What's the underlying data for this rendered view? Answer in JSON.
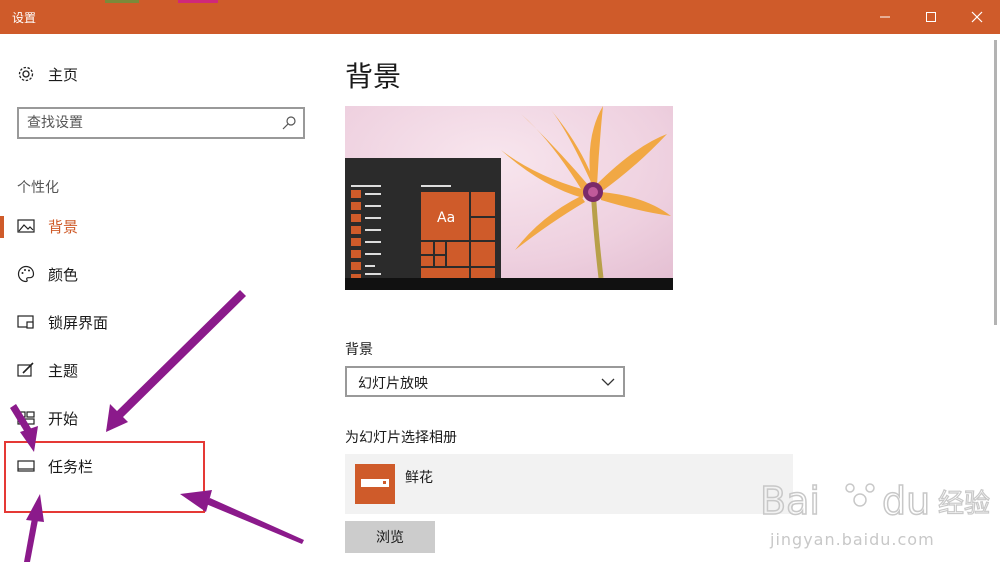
{
  "window": {
    "title": "设置",
    "accent": "#cf5b2a"
  },
  "sidebar": {
    "home_label": "主页",
    "search_placeholder": "查找设置",
    "section_label": "个性化",
    "items": [
      {
        "label": "背景",
        "icon": "picture-icon",
        "active": true
      },
      {
        "label": "颜色",
        "icon": "palette-icon",
        "active": false
      },
      {
        "label": "锁屏界面",
        "icon": "lock-screen-icon",
        "active": false
      },
      {
        "label": "主题",
        "icon": "theme-brush-icon",
        "active": false
      },
      {
        "label": "开始",
        "icon": "start-tiles-icon",
        "active": false
      },
      {
        "label": "任务栏",
        "icon": "taskbar-icon",
        "active": false
      }
    ]
  },
  "main": {
    "page_title": "背景",
    "preview_tile_text": "Aa",
    "background_label": "背景",
    "background_value": "幻灯片放映",
    "album_label": "为幻灯片选择相册",
    "album_name": "鲜花",
    "browse_label": "浏览"
  },
  "watermark": {
    "text": "jingyan.baidu.com",
    "brand": "Baidu 经验"
  }
}
